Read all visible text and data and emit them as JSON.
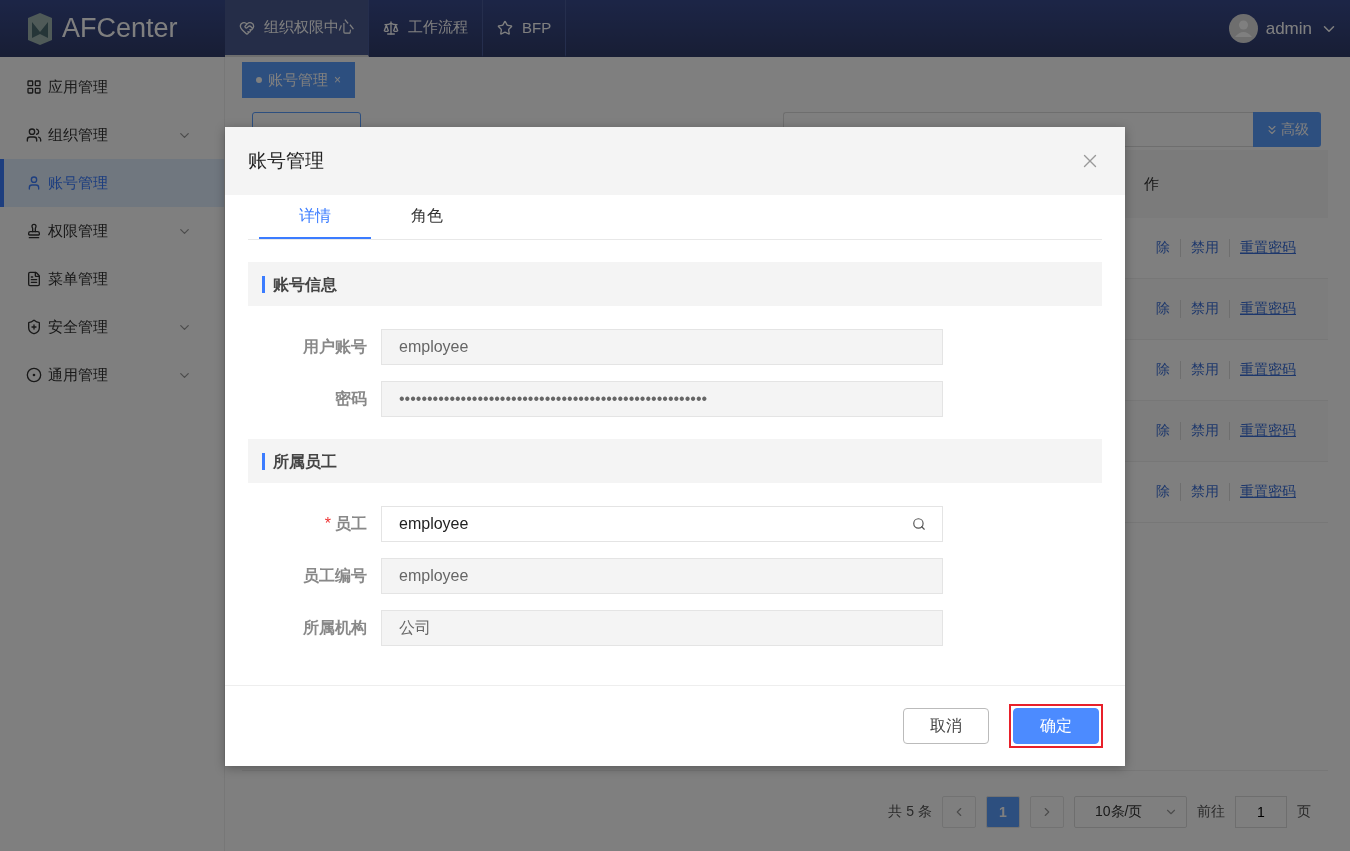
{
  "header": {
    "logo": "AFCenter",
    "nav": [
      {
        "label": "组织权限中心",
        "selected": true
      },
      {
        "label": "工作流程",
        "selected": false
      },
      {
        "label": "BFP",
        "selected": false
      }
    ],
    "user": "admin"
  },
  "sidebar": {
    "items": [
      {
        "label": "应用管理",
        "expandable": false,
        "selected": false
      },
      {
        "label": "组织管理",
        "expandable": true,
        "selected": false
      },
      {
        "label": "账号管理",
        "expandable": false,
        "selected": true
      },
      {
        "label": "权限管理",
        "expandable": true,
        "selected": false
      },
      {
        "label": "菜单管理",
        "expandable": false,
        "selected": false
      },
      {
        "label": "安全管理",
        "expandable": true,
        "selected": false
      },
      {
        "label": "通用管理",
        "expandable": true,
        "selected": false
      }
    ]
  },
  "page_tabs": [
    {
      "label": "账号管理",
      "selected": true,
      "close": "×"
    }
  ],
  "toolbar": {
    "advanced_button": "高级"
  },
  "table": {
    "column_header": "作",
    "rows": [
      {
        "actions": [
          "除",
          "禁用",
          "重置密码"
        ]
      },
      {
        "actions": [
          "除",
          "禁用",
          "重置密码"
        ]
      },
      {
        "actions": [
          "除",
          "禁用",
          "重置密码"
        ]
      },
      {
        "actions": [
          "除",
          "禁用",
          "重置密码"
        ]
      },
      {
        "actions": [
          "除",
          "禁用",
          "重置密码"
        ]
      }
    ]
  },
  "pagination": {
    "total": "共 5 条",
    "pages": [
      {
        "label": "1",
        "selected": true
      }
    ],
    "page_size": "10条/页",
    "goto_label": "前往",
    "goto_value": "1",
    "goto_suffix": "页"
  },
  "dialog": {
    "title": "账号管理",
    "tabs": [
      {
        "label": "详情",
        "selected": true
      },
      {
        "label": "角色",
        "selected": false
      }
    ],
    "sections": [
      {
        "title": "账号信息",
        "fields": [
          {
            "label": "用户账号",
            "value": "employee",
            "disabled": true,
            "search": false
          },
          {
            "label": "密码",
            "value": "•••••••••••••••••••••••••••••••••••••••••••••••••••••••",
            "disabled": true,
            "search": false
          }
        ]
      },
      {
        "title": "所属员工",
        "fields": [
          {
            "label": "员工",
            "required_mark": "*",
            "value": "employee",
            "disabled": false,
            "search": true
          },
          {
            "label": "员工编号",
            "value": "employee",
            "disabled": true,
            "search": false
          },
          {
            "label": "所属机构",
            "value": "公司",
            "disabled": true,
            "search": false
          }
        ]
      }
    ],
    "buttons": [
      {
        "label": "取消",
        "kind": "secondary",
        "highlighted": false
      },
      {
        "label": "确定",
        "kind": "primary",
        "highlighted": true
      }
    ]
  }
}
